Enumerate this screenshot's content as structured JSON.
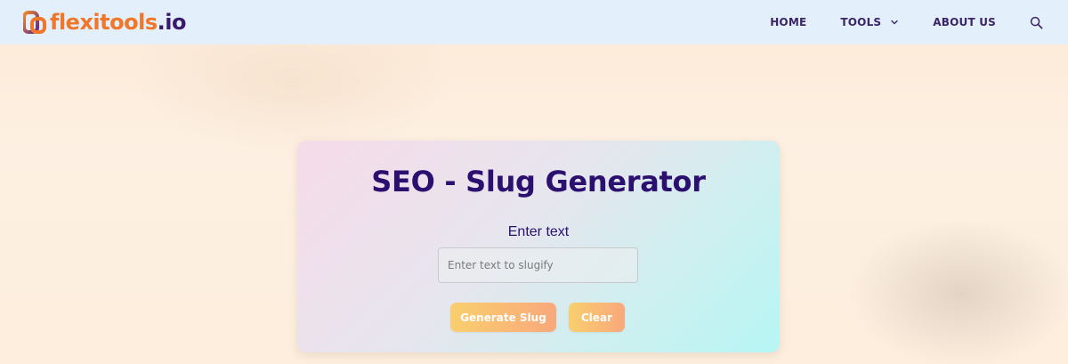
{
  "header": {
    "logo_main": "flexitools",
    "logo_tld": ".io",
    "nav": {
      "home": "HOME",
      "tools": "TOOLS",
      "about": "ABOUT US"
    }
  },
  "card": {
    "title": "SEO - Slug Generator",
    "input_label": "Enter text",
    "input_placeholder": "Enter text to slugify",
    "input_value": "",
    "generate_label": "Generate Slug",
    "clear_label": "Clear"
  },
  "icons": {
    "logo": "flexitools-logo-icon",
    "dropdown": "chevron-down-icon",
    "search": "search-icon"
  },
  "colors": {
    "brand_orange": "#f0762a",
    "brand_purple": "#3b1a6e",
    "title_purple": "#2b1070",
    "header_bg": "#e3f0fb",
    "button_start": "#f9cf6e",
    "button_end": "#f9a87c"
  }
}
